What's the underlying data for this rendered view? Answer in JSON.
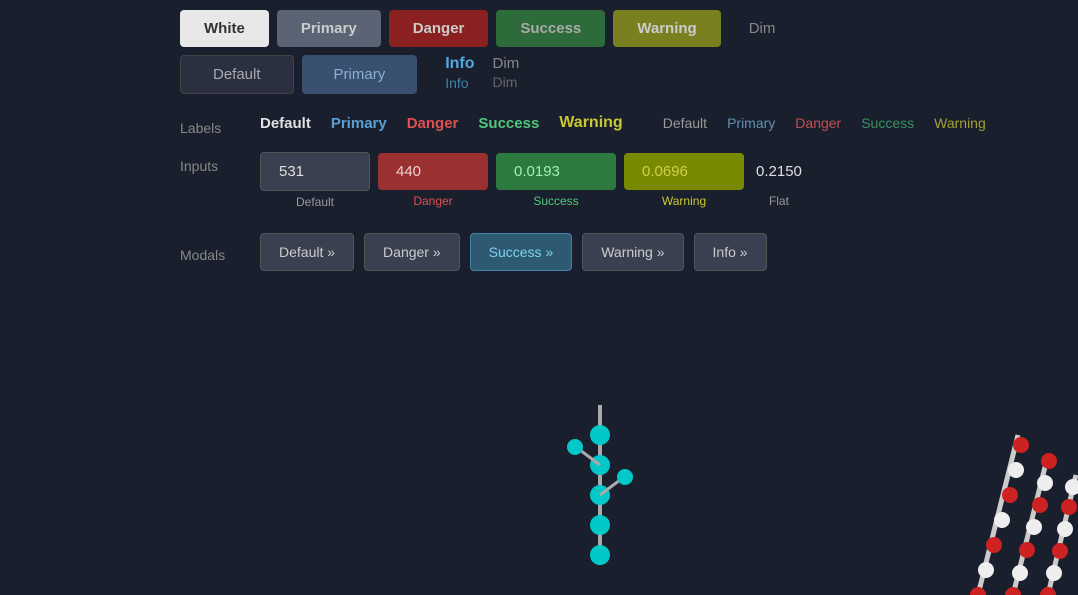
{
  "background_color": "#1a1f2e",
  "top_buttons": {
    "white": "White",
    "primary": "Primary",
    "danger": "Danger",
    "success": "Success",
    "warning": "Warning"
  },
  "second_buttons": {
    "default": "Default",
    "primary": "Primary"
  },
  "labels": {
    "section_title": "Labels",
    "row1": {
      "default": "Default",
      "primary": "Primary",
      "danger": "Danger",
      "success": "Success",
      "warning": "Warning",
      "info": "Info",
      "dim": "Dim"
    },
    "row2": {
      "default": "Default",
      "primary": "Primary",
      "danger": "Danger",
      "success": "Success",
      "warning": "Warning",
      "info": "Info",
      "dim": "Dim"
    }
  },
  "inputs": {
    "section_title": "Inputs",
    "default_value": "531",
    "danger_value": "440",
    "success_value": "0.0193",
    "warning_value": "0.0696",
    "flat_value": "0.2150",
    "default_label": "Default",
    "danger_label": "Danger",
    "success_label": "Success",
    "warning_label": "Warning",
    "flat_label": "Flat"
  },
  "modals": {
    "section_title": "Modals",
    "default": "Default »",
    "danger": "Danger »",
    "success": "Success »",
    "warning": "Warning »",
    "info": "Info »"
  }
}
